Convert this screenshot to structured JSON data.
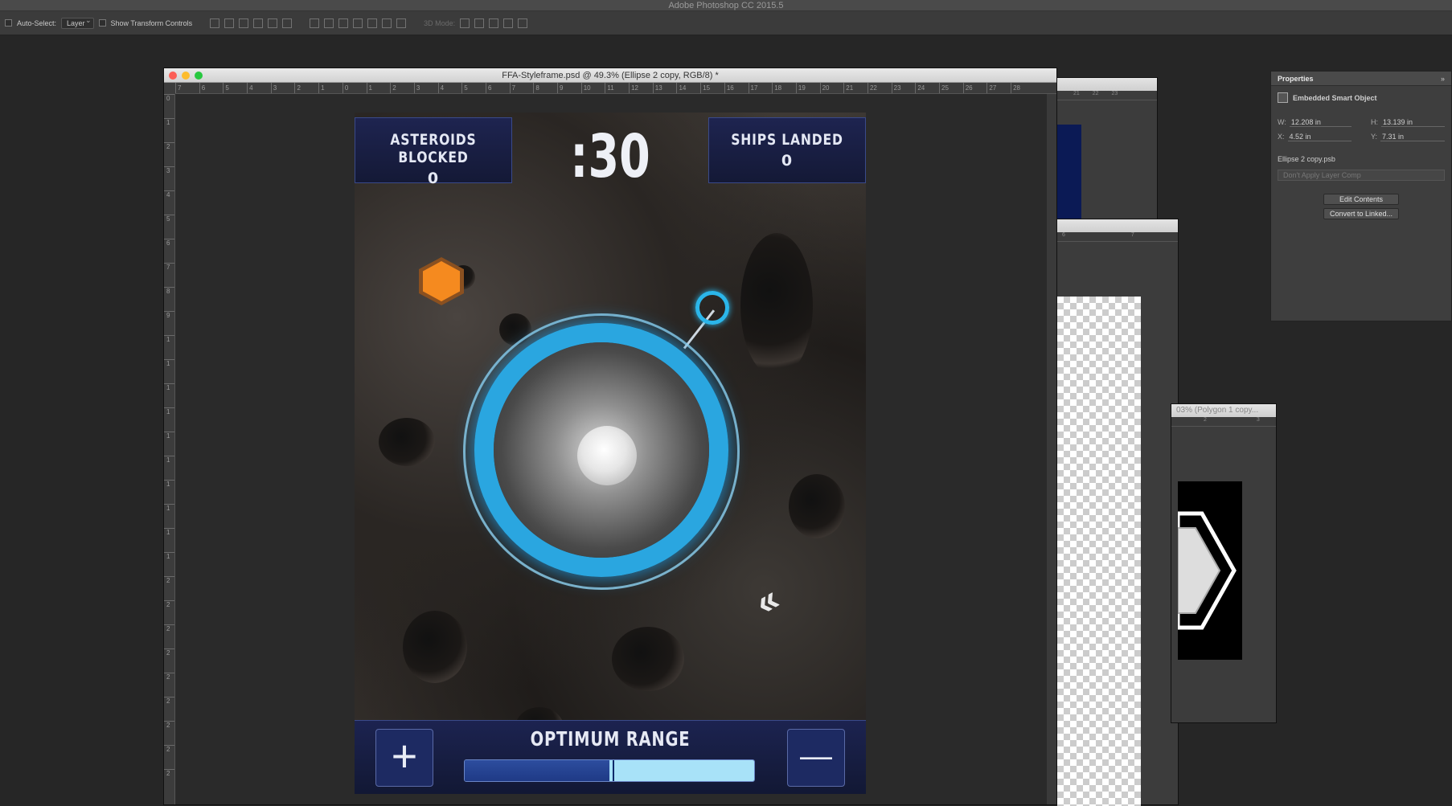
{
  "app": {
    "title": "Adobe Photoshop CC 2015.5"
  },
  "options_bar": {
    "auto_select_label": "Auto-Select:",
    "auto_select_value": "Layer",
    "show_transform_label": "Show Transform Controls",
    "mode_3d_label": "3D Mode:"
  },
  "document": {
    "title": "FFA-Styleframe.psd @ 49.3% (Ellipse 2 copy, RGB/8) *",
    "ruler_h": [
      "7",
      "6",
      "5",
      "4",
      "3",
      "2",
      "1",
      "0",
      "1",
      "2",
      "3",
      "4",
      "5",
      "6",
      "7",
      "8",
      "9",
      "10",
      "11",
      "12",
      "13",
      "14",
      "15",
      "16",
      "17",
      "18",
      "19",
      "20",
      "21",
      "22",
      "23",
      "24",
      "25",
      "26",
      "27",
      "28"
    ],
    "ruler_v": [
      "0",
      "1",
      "2",
      "3",
      "4",
      "5",
      "6",
      "7",
      "8",
      "9",
      "1",
      "1",
      "1",
      "1",
      "1",
      "1",
      "1",
      "1",
      "1",
      "1",
      "2",
      "2",
      "2",
      "2",
      "2",
      "2",
      "2",
      "2",
      "2"
    ]
  },
  "artwork": {
    "left_hud": {
      "title": "ASTEROIDS BLOCKED",
      "value": "0"
    },
    "timer": ":30",
    "right_hud": {
      "title": "SHIPS LANDED",
      "value": "0"
    },
    "bottom": {
      "plus": "+",
      "minus": "—",
      "label": "OPTIMUM RANGE",
      "range_fill": 0.5,
      "range_highlight_start": 0.5,
      "range_highlight_end": 1.0
    },
    "colors": {
      "accent": "#2aa6e0",
      "hex": "#f58a1f",
      "hud_bg": "#1e2450"
    }
  },
  "bg_windows": {
    "win3_title": "03% (Polygon 1 copy...",
    "ruler_a": [
      "21",
      "22",
      "23"
    ],
    "ruler_b": [
      "6",
      "7"
    ],
    "ruler_c": [
      "2",
      "3"
    ]
  },
  "properties": {
    "title": "Properties",
    "collapse": "»",
    "type_label": "Embedded Smart Object",
    "w_label": "W:",
    "w_value": "12.208 in",
    "h_label": "H:",
    "h_value": "13.139 in",
    "x_label": "X:",
    "x_value": "4.52 in",
    "y_label": "Y:",
    "y_value": "7.31 in",
    "filename": "Ellipse 2 copy.psb",
    "layer_comp": "Don't Apply Layer Comp",
    "edit_contents": "Edit Contents",
    "convert_linked": "Convert to Linked..."
  }
}
